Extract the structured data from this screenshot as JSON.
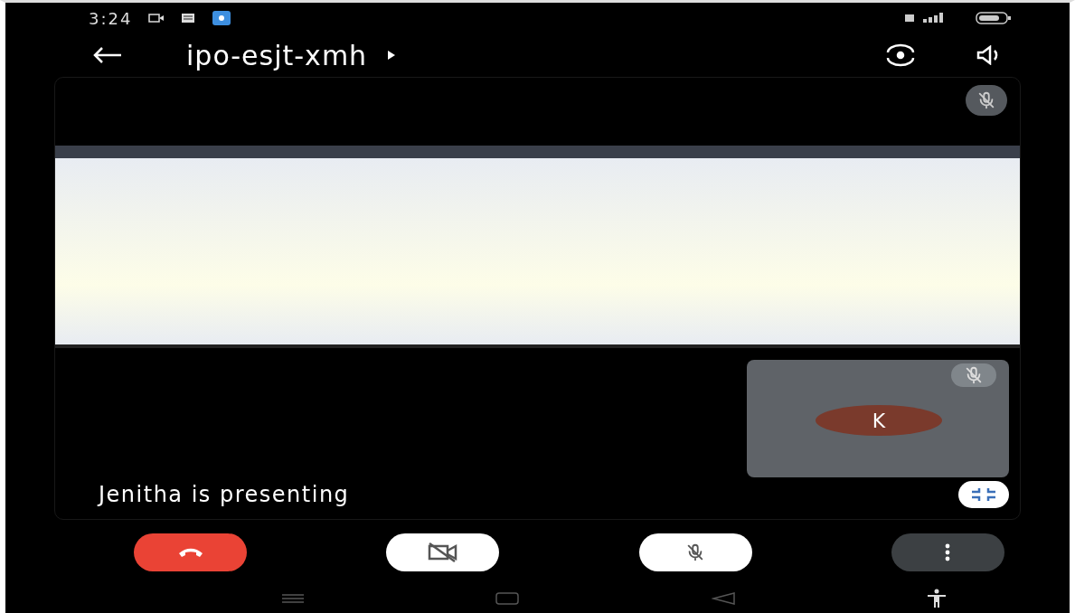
{
  "status_bar": {
    "time": "3:24"
  },
  "header": {
    "title": "ipo-esjt-xmh"
  },
  "stage": {
    "presenter_muted": true,
    "caption": "Jenitha is presenting"
  },
  "participant": {
    "initial": "K",
    "muted": true
  },
  "controls": {
    "camera_on": false,
    "mic_on": false
  }
}
